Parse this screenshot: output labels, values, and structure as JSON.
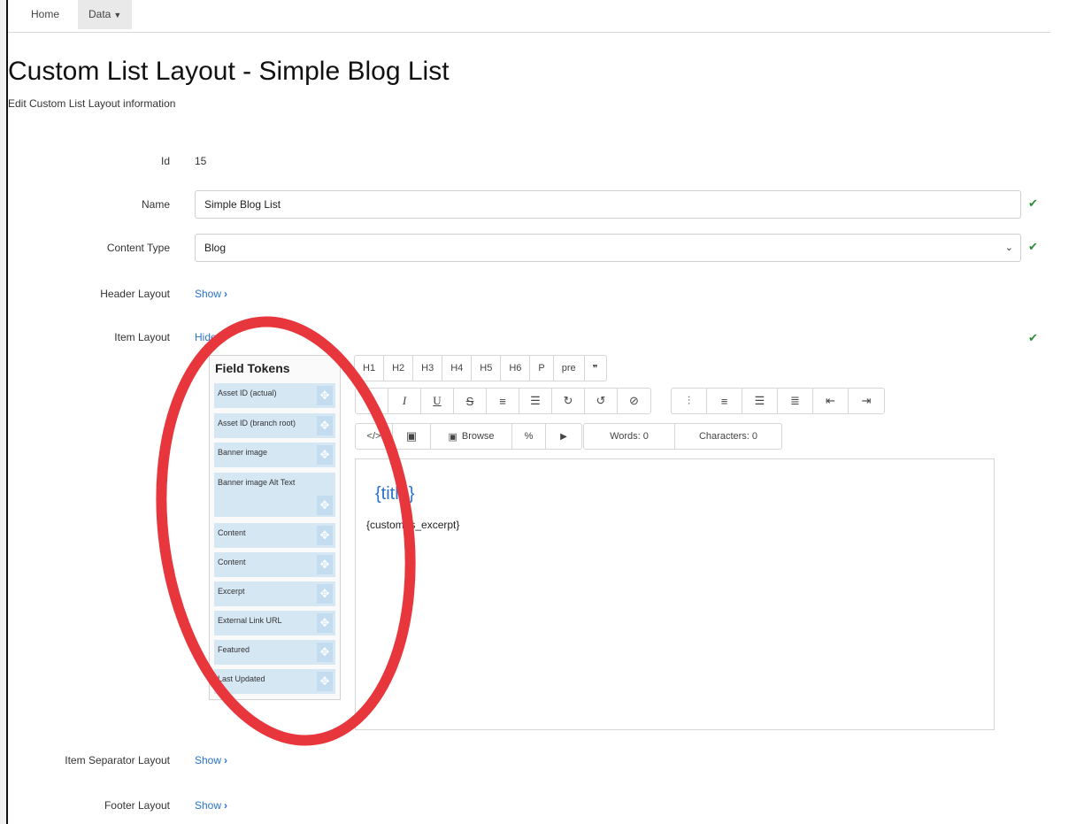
{
  "nav": {
    "home": "Home",
    "data": "Data"
  },
  "page": {
    "title": "Custom List Layout - Simple Blog List",
    "subtitle": "Edit Custom List Layout information"
  },
  "form": {
    "id_label": "Id",
    "id_value": "15",
    "name_label": "Name",
    "name_value": "Simple Blog List",
    "content_type_label": "Content Type",
    "content_type_value": "Blog",
    "header_layout_label": "Header Layout",
    "header_layout_link": "Show",
    "item_layout_label": "Item Layout",
    "item_layout_link": "Hide",
    "item_separator_label": "Item Separator Layout",
    "item_separator_link": "Show",
    "footer_layout_label": "Footer Layout",
    "footer_layout_link": "Show"
  },
  "tokens": {
    "title": "Field Tokens",
    "items": [
      "Asset ID (actual)",
      "Asset ID (branch root)",
      "Banner image",
      "Banner image Alt Text",
      "Content",
      "Content",
      "Excerpt",
      "External Link URL",
      "Featured",
      "Last Updated"
    ]
  },
  "toolbar": {
    "headings": [
      "H1",
      "H2",
      "H3",
      "H4",
      "H5",
      "H6",
      "P",
      "pre"
    ],
    "quote_glyph": "❞",
    "format_glyphs": [
      "B",
      "I",
      "U",
      "S",
      "≡",
      "☰",
      "↻",
      "↺",
      "⊘"
    ],
    "align_glyphs": [
      "⫶",
      "≡",
      "☰",
      "≣",
      "⇤",
      "⇥"
    ],
    "code_glyph": "</>",
    "image_glyph": "▣",
    "browse": "Browse",
    "link_glyph": "%",
    "video_glyph": "▶",
    "words": "Words: 0",
    "characters": "Characters: 0"
  },
  "editor": {
    "title_token": "{title}",
    "excerpt_token": "{custom_s_excerpt}"
  },
  "colors": {
    "accent": "#2a73c9",
    "success": "#2e8b3a",
    "token_bg": "#d6e7f4",
    "annotation": "#e8373c"
  }
}
